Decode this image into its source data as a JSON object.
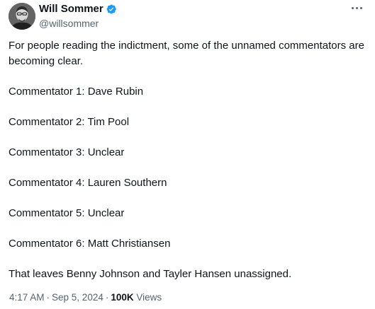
{
  "author": {
    "display_name": "Will Sommer",
    "handle": "@willsommer",
    "verified_icon": "verified-badge-icon",
    "verified_color": "#1d9bf0"
  },
  "more_icon": "more-options-icon",
  "tweet": {
    "paragraphs": [
      "For people reading the indictment, some of the unnamed commentators are becoming clear.",
      "Commentator 1: Dave Rubin",
      "Commentator 2: Tim Pool",
      "Commentator 3: Unclear",
      "Commentator 4: Lauren Southern",
      "Commentator 5: Unclear",
      "Commentator 6: Matt Christiansen",
      "That leaves Benny Johnson and Tayler Hansen unassigned."
    ]
  },
  "meta": {
    "time": "4:17 AM",
    "separator": "·",
    "date": "Sep 5, 2024",
    "views_count": "100K",
    "views_label": "Views"
  },
  "colors": {
    "text": "#0f1419",
    "secondary": "#536471"
  }
}
